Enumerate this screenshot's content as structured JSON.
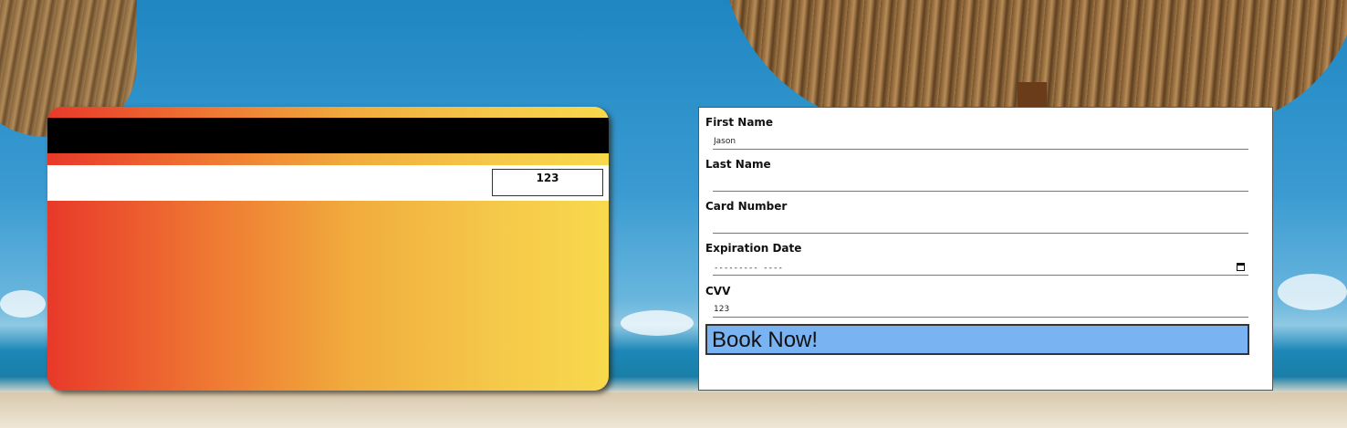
{
  "card": {
    "cvv_display": "123"
  },
  "form": {
    "first_name": {
      "label": "First Name",
      "value": "Jason"
    },
    "last_name": {
      "label": "Last Name",
      "value": ""
    },
    "card_number": {
      "label": "Card Number",
      "value": ""
    },
    "expiration_date": {
      "label": "Expiration Date",
      "placeholder": "---------  ----"
    },
    "cvv": {
      "label": "CVV",
      "value": "123"
    },
    "submit_label": "Book Now!"
  },
  "colors": {
    "button_bg": "#7ab3f2",
    "card_gradient_start": "#e8392a",
    "card_gradient_end": "#f8d94c"
  },
  "icons": {
    "date_picker": "calendar-icon"
  }
}
